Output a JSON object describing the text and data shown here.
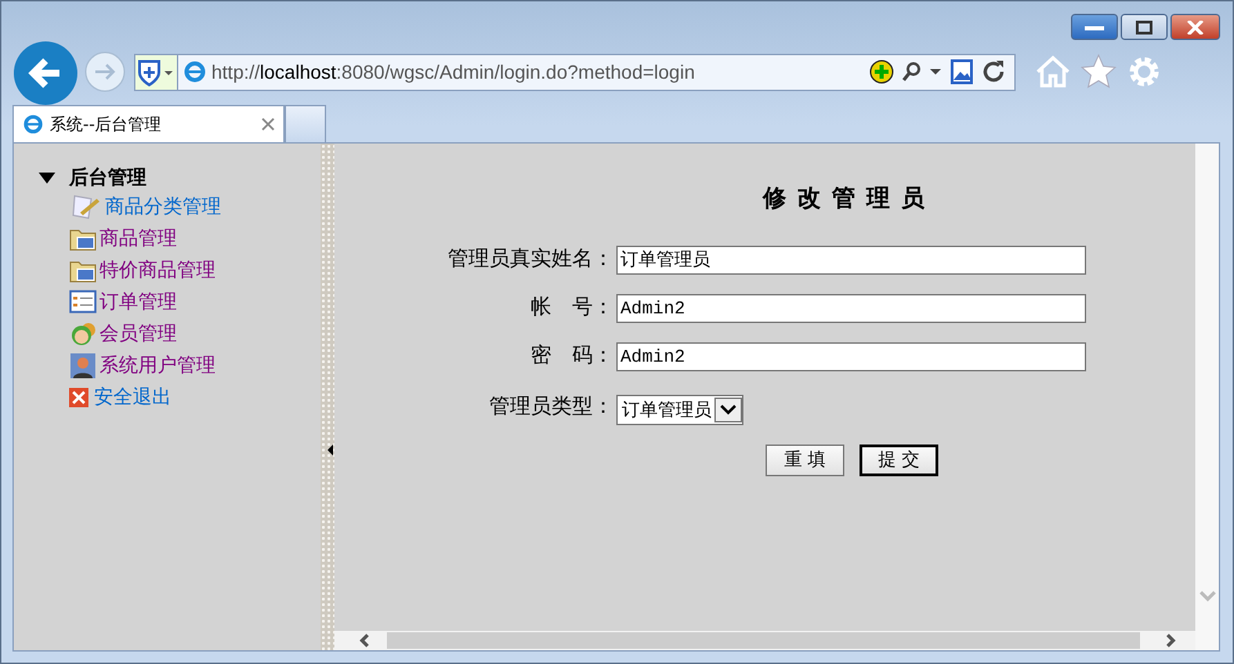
{
  "browser": {
    "address": {
      "scheme": "http://",
      "host": "localhost",
      "rest": ":8080/wgsc/Admin/login.do?method=login"
    },
    "tabs": [
      {
        "title": "系统--后台管理",
        "selected": true
      }
    ]
  },
  "sidebar": {
    "title": "后台管理",
    "expanded": true,
    "items": [
      {
        "label": "商品分类管理",
        "kind": "edit",
        "visited": false
      },
      {
        "label": "商品管理",
        "kind": "folder",
        "visited": true
      },
      {
        "label": "特价商品管理",
        "kind": "folder",
        "visited": true
      },
      {
        "label": "订单管理",
        "kind": "list",
        "visited": true
      },
      {
        "label": "会员管理",
        "kind": "people",
        "visited": true
      },
      {
        "label": "系统用户管理",
        "kind": "user",
        "visited": true
      },
      {
        "label": "安全退出",
        "kind": "exit",
        "visited": false
      }
    ]
  },
  "form": {
    "title": "修 改 管 理 员",
    "fields": [
      {
        "kind": "text",
        "label": "管理员真实姓名：",
        "value": "订单管理员"
      },
      {
        "kind": "text",
        "label": "帐　号：",
        "value": "Admin2"
      },
      {
        "kind": "text",
        "label": "密　码：",
        "value": "Admin2"
      },
      {
        "kind": "select",
        "label": "管理员类型：",
        "value": "订单管理员"
      }
    ],
    "buttons": [
      {
        "label": "重 填",
        "default": false
      },
      {
        "label": "提 交",
        "default": true
      }
    ]
  }
}
